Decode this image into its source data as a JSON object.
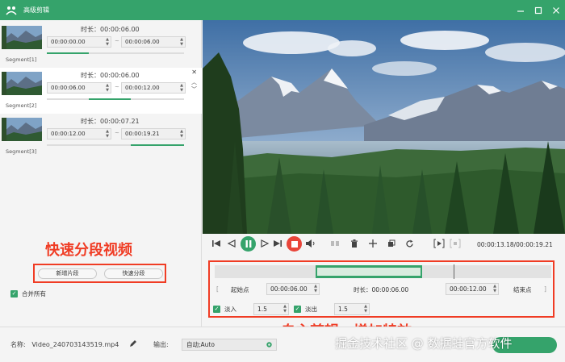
{
  "window": {
    "title": "高级剪辑"
  },
  "segments": [
    {
      "label": "Segment[1]",
      "duration_label": "时长：00:00:06.00",
      "start": "00:00:00.00",
      "end": "00:00:06.00"
    },
    {
      "label": "Segment[2]",
      "duration_label": "时长：00:00:06.00",
      "start": "00:00:06.00",
      "end": "00:00:12.00"
    },
    {
      "label": "Segment[3]",
      "duration_label": "时长：00:00:07.21",
      "start": "00:00:12.00",
      "end": "00:00:19.21"
    }
  ],
  "left_actions": {
    "new_segment": "新增片段",
    "quick_split": "快速分段",
    "merge_all": "合并所有",
    "annotation": "快速分段视频"
  },
  "player": {
    "timecode": "00:00:13.18/00:00:19.21"
  },
  "trim": {
    "start_label": "起始点",
    "start_value": "00:00:06.00",
    "duration_label": "时长：00:00:06.00",
    "end_value": "00:00:12.00",
    "end_label": "结束点",
    "fade_in_label": "淡入",
    "fade_in_value": "1.5",
    "fade_out_label": "淡出",
    "fade_out_value": "1.5",
    "annotation": "自主剪辑，增加特效"
  },
  "bottom": {
    "filename_label": "名称:",
    "filename": "Video_240703143519.mp4",
    "output_label": "输出:",
    "output_value": "自动;Auto"
  },
  "watermark": "掘金技术社区 @ 数据蛙官方软件",
  "colors": {
    "accent": "#35a36b",
    "annotation": "#f03c24"
  }
}
